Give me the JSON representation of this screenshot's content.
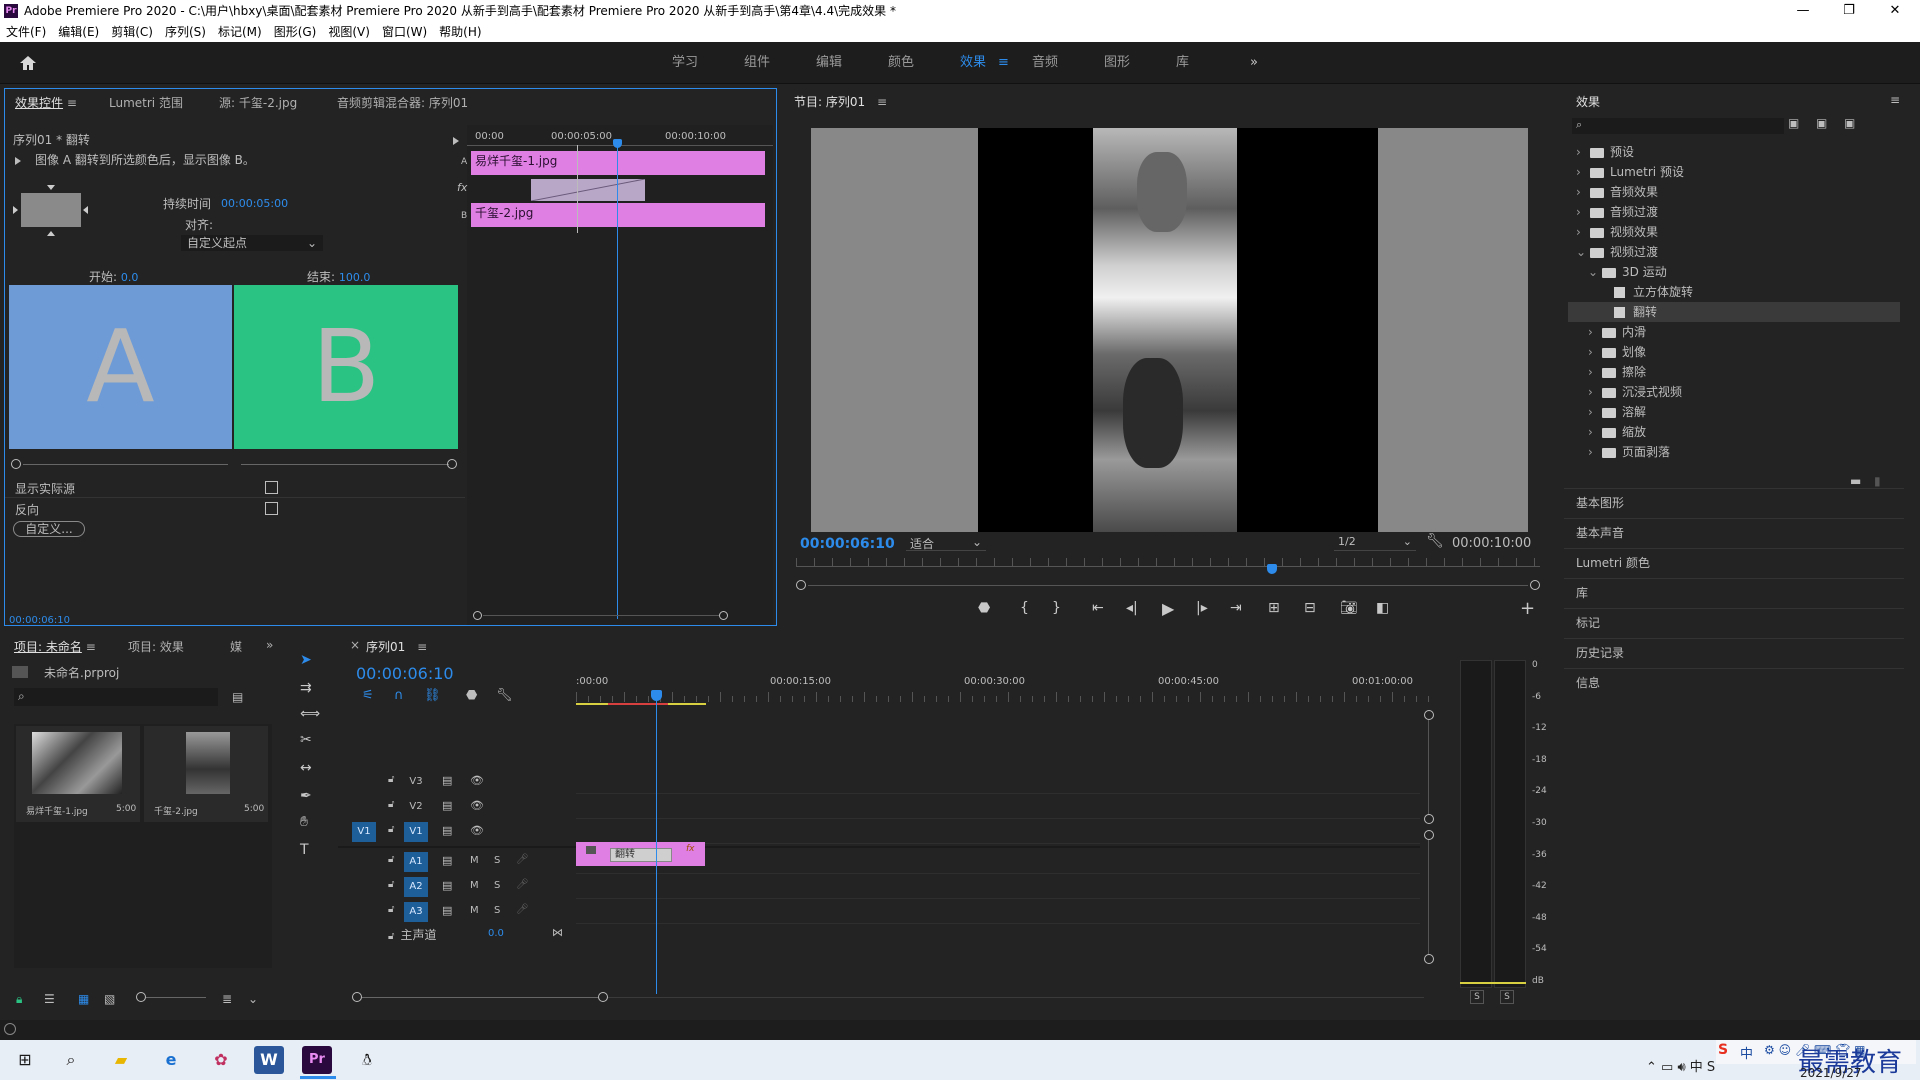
{
  "titlebar": {
    "logo": "Pr",
    "title": "Adobe Premiere Pro 2020 - C:\\用户\\hbxy\\桌面\\配套素材 Premiere Pro 2020 从新手到高手\\配套素材 Premiere Pro 2020 从新手到高手\\第4章\\4.4\\完成效果 *",
    "minimize": "—",
    "restore": "❐",
    "close": "✕"
  },
  "menu": [
    "文件(F)",
    "编辑(E)",
    "剪辑(C)",
    "序列(S)",
    "标记(M)",
    "图形(G)",
    "视图(V)",
    "窗口(W)",
    "帮助(H)"
  ],
  "workspaces": [
    "学习",
    "组件",
    "编辑",
    "颜色",
    "效果",
    "音频",
    "图形",
    "库"
  ],
  "workspace_active": "效果",
  "workspace_more": "»",
  "effect_controls": {
    "tabs": [
      "效果控件",
      "Lumetri 范围",
      "源: 千玺-2.jpg",
      "音频剪辑混合器: 序列01"
    ],
    "sequence": "序列01 * 翻转",
    "description": "图像 A 翻转到所选颜色后，显示图像 B。",
    "duration_label": "持续时间",
    "duration_value": "00:00:05:00",
    "align_label": "对齐:",
    "align_value": "自定义起点",
    "start_label": "开始:",
    "start_value": "0.0",
    "end_label": "结束:",
    "end_value": "100.0",
    "preview_a": "A",
    "preview_b": "B",
    "show_actual": "显示实际源",
    "reverse": "反向",
    "custom_button": "自定义...",
    "timecode": "00:00:06:10",
    "mini_ruler": [
      "00:00",
      "00:00:05:00",
      "00:00:10:00"
    ],
    "clip_a": "易烊千玺-1.jpg",
    "clip_b": "千玺-2.jpg",
    "track_a": "A",
    "track_b": "B",
    "fx": "fx"
  },
  "program_monitor": {
    "title": "节目: 序列01",
    "timecode": "00:00:06:10",
    "fit": "适合",
    "resolution": "1/2",
    "duration": "00:00:10:00"
  },
  "effects_panel": {
    "title": "效果",
    "tree": [
      {
        "label": "预设",
        "level": 0,
        "open": false
      },
      {
        "label": "Lumetri 预设",
        "level": 0,
        "open": false
      },
      {
        "label": "音频效果",
        "level": 0,
        "open": false
      },
      {
        "label": "音频过渡",
        "level": 0,
        "open": false
      },
      {
        "label": "视频效果",
        "level": 0,
        "open": false
      },
      {
        "label": "视频过渡",
        "level": 0,
        "open": true
      },
      {
        "label": "3D 运动",
        "level": 1,
        "open": true
      },
      {
        "label": "立方体旋转",
        "level": 2,
        "item": true
      },
      {
        "label": "翻转",
        "level": 2,
        "item": true,
        "selected": true
      },
      {
        "label": "内滑",
        "level": 1,
        "open": false
      },
      {
        "label": "划像",
        "level": 1,
        "open": false
      },
      {
        "label": "擦除",
        "level": 1,
        "open": false
      },
      {
        "label": "沉浸式视频",
        "level": 1,
        "open": false
      },
      {
        "label": "溶解",
        "level": 1,
        "open": false
      },
      {
        "label": "缩放",
        "level": 1,
        "open": false
      },
      {
        "label": "页面剥落",
        "level": 1,
        "open": false
      }
    ],
    "sections": [
      "基本图形",
      "基本声音",
      "Lumetri 颜色",
      "库",
      "标记",
      "历史记录",
      "信息"
    ]
  },
  "project_panel": {
    "tabs": [
      "项目: 未命名",
      "项目: 效果",
      "媒"
    ],
    "file": "未命名.prproj",
    "items": [
      {
        "name": "易烊千玺-1.jpg",
        "duration": "5:00"
      },
      {
        "name": "千玺-2.jpg",
        "duration": "5:00"
      }
    ]
  },
  "timeline": {
    "title": "序列01",
    "timecode": "00:00:06:10",
    "ruler": [
      ":00:00",
      "00:00:15:00",
      "00:00:30:00",
      "00:00:45:00",
      "00:01:00:00"
    ],
    "tracks": [
      "V3",
      "V2",
      "V1",
      "A1",
      "A2",
      "A3"
    ],
    "source_patch": "V1",
    "master": "主声道",
    "master_value": "0.0",
    "clip_label": "翻转",
    "clip_fx": "fx",
    "mute": "M",
    "solo": "S"
  },
  "audio_meter": {
    "scale": [
      "0",
      "-6",
      "-12",
      "-18",
      "-24",
      "-30",
      "-36",
      "-42",
      "-48",
      "-54",
      "dB"
    ],
    "solo_left": "S",
    "solo_right": "S"
  },
  "taskbar": {
    "date": "2021/9/27",
    "ime": "中",
    "watermark": "最需教育"
  },
  "colors": {
    "accent": "#2d8ceb",
    "clip_pink": "#e07fe3",
    "preview_a": "#6e9bd6",
    "preview_b": "#2bc383"
  }
}
